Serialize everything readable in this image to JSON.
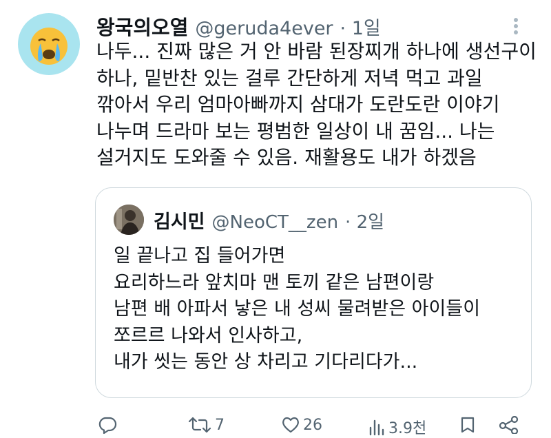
{
  "author": {
    "name": "왕국의오열",
    "handle": "@geruda4ever",
    "time": "· 1일"
  },
  "tweet": {
    "lines": [
      "나두... 진짜 많은 거 안 바람 된장찌개 하나에 생선구이",
      "하나, 밑반찬 있는 걸루 간단하게 저녁 먹고 과일",
      "깎아서 우리 엄마아빠까지 삼대가 도란도란 이야기",
      "나누며 드라마 보는 평범한 일상이 내 꿈임... 나는",
      "설거지도 도와줄 수 있음.  재활용도 내가 하겠음"
    ]
  },
  "quote": {
    "name": "김시민",
    "handle": "@NeoCT__zen",
    "time": "· 2일",
    "lines": [
      "일 끝나고 집 들어가면",
      "요리하느라 앞치마 맨 토끼 같은 남편이랑",
      "남편 배 아파서 낳은 내 성씨 물려받은 아이들이",
      "쪼르르 나와서 인사하고,",
      "내가 씻는 동안 상 차리고 기다리다가..."
    ]
  },
  "actions": {
    "reply_count": "",
    "retweet_count": "7",
    "like_count": "26",
    "view_count": "3.9천"
  },
  "icons": {
    "avatar": "crying-face-emoji",
    "reply": "reply-icon",
    "retweet": "retweet-icon",
    "like": "heart-icon",
    "views": "views-icon",
    "bookmark": "bookmark-icon",
    "share": "share-icon",
    "more": "more-icon"
  },
  "colors": {
    "text": "#0f1419",
    "muted": "#536471",
    "border": "#cfd9de",
    "avatar_bg": "#a9e4ef"
  }
}
